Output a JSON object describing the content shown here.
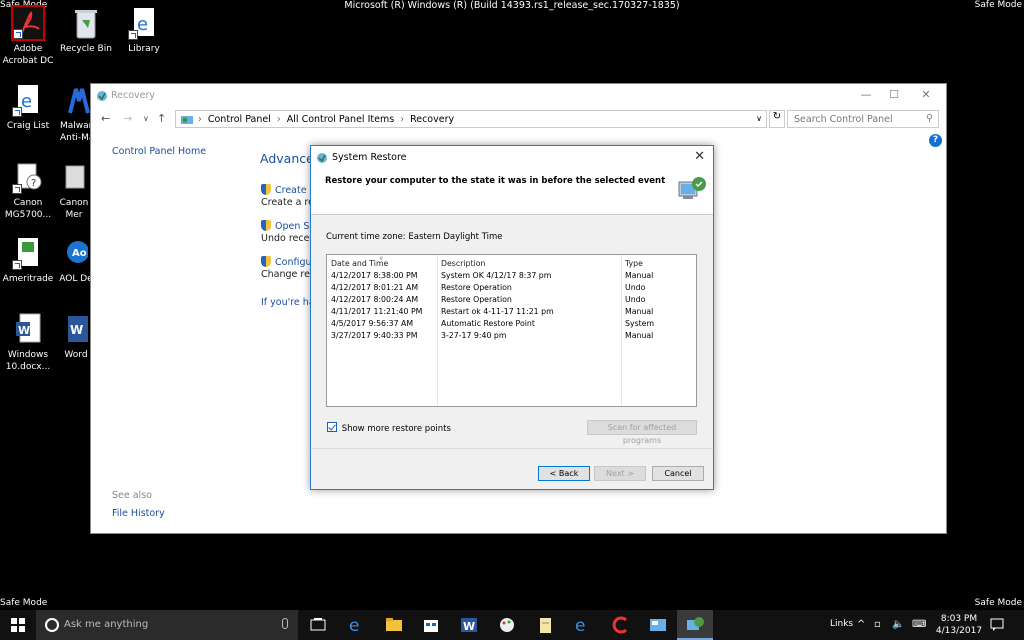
{
  "corners": {
    "safe_mode": "Safe Mode"
  },
  "build": "Microsoft (R) Windows (R) (Build 14393.rs1_release_sec.170327-1835)",
  "desktop": {
    "icons": [
      {
        "label": "Adobe Acrobat DC"
      },
      {
        "label": "Recycle Bin"
      },
      {
        "label": "Library"
      },
      {
        "label": "Craig List"
      },
      {
        "label": "Malwar Anti-Ma"
      },
      {
        "label": "Canon MG5700..."
      },
      {
        "label": "Canon Mer"
      },
      {
        "label": "Ameritrade"
      },
      {
        "label": "AOL De"
      },
      {
        "label": "Windows 10.docx..."
      },
      {
        "label": "Word"
      }
    ]
  },
  "recovery": {
    "title": "Recovery",
    "breadcrumb": [
      "Control Panel",
      "All Control Panel Items",
      "Recovery"
    ],
    "search_placeholder": "Search Control Panel",
    "cp_home": "Control Panel Home",
    "advanced_title": "Advanced",
    "links": [
      {
        "label": "Create a",
        "desc": "Create a reco"
      },
      {
        "label": "Open Sys",
        "desc": "Undo recent"
      },
      {
        "label": "Configure",
        "desc": "Change resto"
      }
    ],
    "if_youre": "If you're havi",
    "see_also": "See also",
    "file_history": "File History"
  },
  "system_restore": {
    "title": "System Restore",
    "heading": "Restore your computer to the state it was in before the selected event",
    "timezone": "Current time zone: Eastern Daylight Time",
    "columns": [
      "Date and Time",
      "Description",
      "Type"
    ],
    "rows": [
      {
        "date": "4/12/2017 8:38:00 PM",
        "desc": "System OK 4/12/17  8:37 pm",
        "type": "Manual"
      },
      {
        "date": "4/12/2017 8:01:21 AM",
        "desc": "Restore Operation",
        "type": "Undo"
      },
      {
        "date": "4/12/2017 8:00:24 AM",
        "desc": "Restore Operation",
        "type": "Undo"
      },
      {
        "date": "4/11/2017 11:21:40 PM",
        "desc": "Restart ok 4-11-17 11:21 pm",
        "type": "Manual"
      },
      {
        "date": "4/5/2017 9:56:37 AM",
        "desc": "Automatic Restore Point",
        "type": "System"
      },
      {
        "date": "3/27/2017 9:40:33 PM",
        "desc": "3-27-17  9:40 pm",
        "type": "Manual"
      }
    ],
    "show_more": "Show more restore points",
    "scan_btn": "Scan for affected programs",
    "back_btn": "< Back",
    "next_btn": "Next >",
    "cancel_btn": "Cancel"
  },
  "taskbar": {
    "search_placeholder": "Ask me anything",
    "links": "Links",
    "time": "8:03 PM",
    "date": "4/13/2017"
  }
}
